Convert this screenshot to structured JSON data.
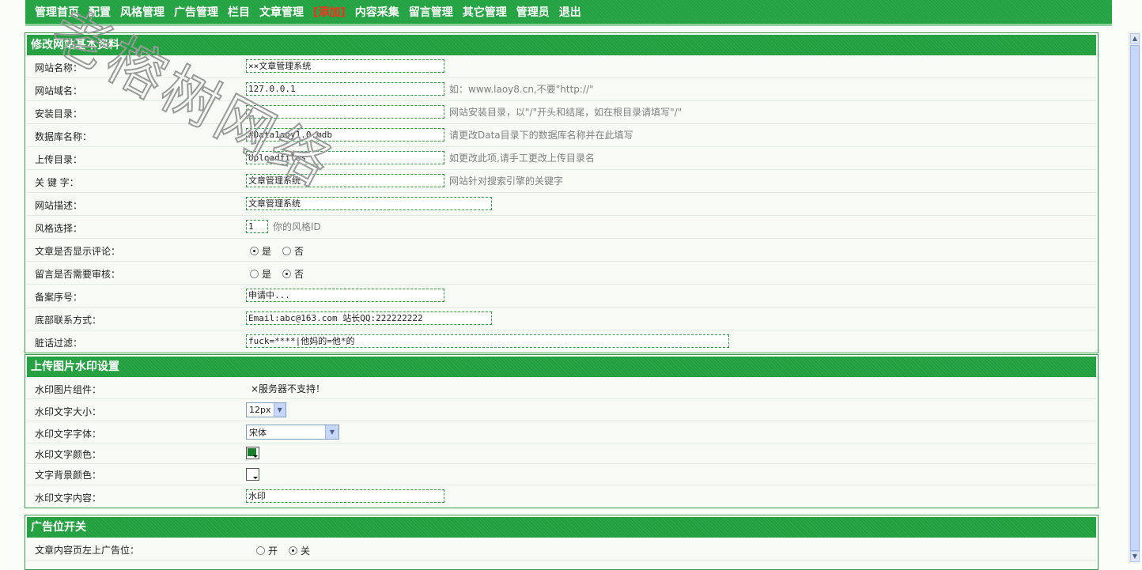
{
  "nav": {
    "items": [
      {
        "label": "管理首页"
      },
      {
        "label": "配置"
      },
      {
        "label": "风格管理"
      },
      {
        "label": "广告管理"
      },
      {
        "label": "栏目"
      },
      {
        "label": "文章管理"
      },
      {
        "label": "[添加]",
        "highlight": true
      },
      {
        "label": "内容采集"
      },
      {
        "label": "留言管理"
      },
      {
        "label": "其它管理"
      },
      {
        "label": "管理员"
      },
      {
        "label": "退出"
      }
    ]
  },
  "site_panel": {
    "title": "修改网站基本资料",
    "site_name": {
      "label": "网站名称：",
      "value": "××文章管理系统"
    },
    "domain": {
      "label": "网站域名：",
      "value": "127.0.0.1",
      "hint": "如：www.laoy8.cn,不要\"http://\""
    },
    "install_dir": {
      "label": "安装目录：",
      "value": "/",
      "hint": "网站安装目录，以\"/\"开头和结尾，如在根目录请填写\"/\""
    },
    "db_name": {
      "label": "数据库名称：",
      "value": "#Data1aoy1.0.mdb",
      "hint": "请更改Data目录下的数据库名称并在此填写"
    },
    "upload_dir": {
      "label": "上传目录：",
      "value": "Uploadfiles",
      "hint": "如更改此项,请手工更改上传目录名"
    },
    "keywords": {
      "label": "关 键 字：",
      "value": "文章管理系统",
      "hint": "网站针对搜索引擎的关键字"
    },
    "description": {
      "label": "网站描述：",
      "value": "文章管理系统"
    },
    "style": {
      "label": "风格选择：",
      "value": "1",
      "hint": "你的风格ID"
    },
    "show_comments": {
      "label": "文章是否显示评论：",
      "yes": "是",
      "no": "否",
      "selected": "yes"
    },
    "review_msgs": {
      "label": "留言是否需要审核：",
      "yes": "是",
      "no": "否",
      "selected": "no"
    },
    "icp": {
      "label": "备案序号：",
      "value": "申请中..."
    },
    "contact": {
      "label": "底部联系方式：",
      "value": "Email:abc@163.com 站长QQ:222222222"
    },
    "filter": {
      "label": "脏话过滤：",
      "value": "fuck=****|他妈的=他*的"
    }
  },
  "watermark_panel": {
    "title": "上传图片水印设置",
    "component": {
      "label": "水印图片组件：",
      "value": "×服务器不支持！"
    },
    "font_size": {
      "label": "水印文字大小：",
      "value": "12px"
    },
    "font_face": {
      "label": "水印文字字体：",
      "value": "宋体"
    },
    "font_color": {
      "label": "水印文字颜色：",
      "color": "#1a7f2a"
    },
    "bg_color": {
      "label": "文字背景颜色：",
      "color": "#ffffff"
    },
    "text": {
      "label": "水印文字内容：",
      "value": "水印"
    }
  },
  "ad_panel": {
    "title": "广告位开关",
    "top_left": {
      "label": "文章内容页左上广告位：",
      "on": "开",
      "off": "关",
      "selected": "off"
    }
  },
  "overlay": {
    "watermark_text": "老榕树网络"
  }
}
